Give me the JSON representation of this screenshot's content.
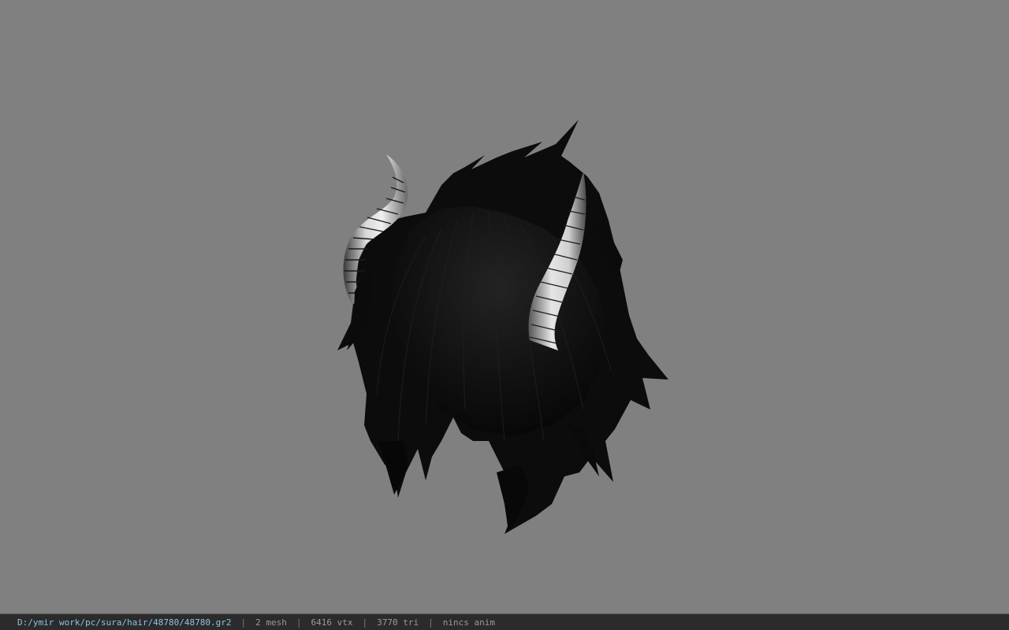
{
  "viewer": {
    "background_color": "#808080",
    "model_description_icon": "hair-with-horns-model"
  },
  "status_bar": {
    "file_path": "D:/ymir work/pc/sura/hair/48780/48780.gr2",
    "separator": "|",
    "mesh_count": "2 mesh",
    "vertex_count": "6416 vtx",
    "triangle_count": "3770 tri",
    "animation_status": "nincs anim",
    "path_color": "#8fc2e0",
    "text_color": "#9a9a9a",
    "bar_color": "#2b2b2b"
  }
}
